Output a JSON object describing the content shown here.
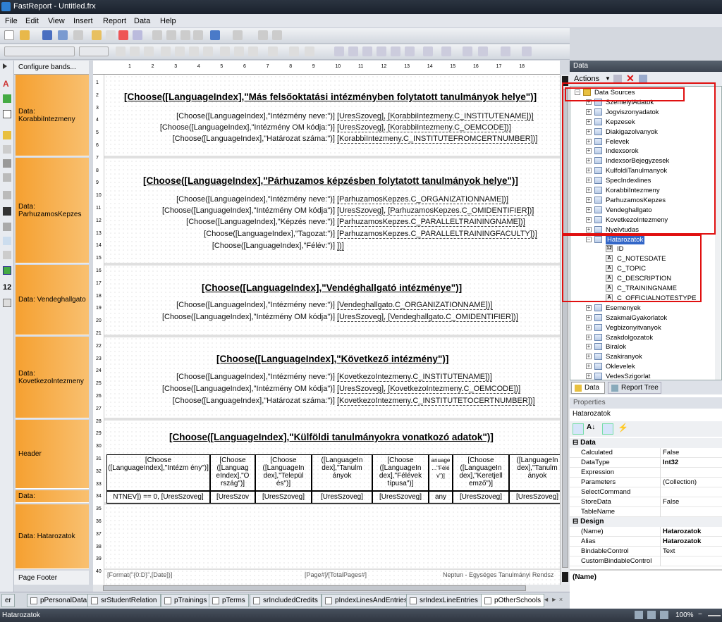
{
  "window": {
    "title": "FastReport - Untitled.frx"
  },
  "menu": [
    "File",
    "Edit",
    "View",
    "Insert",
    "Report",
    "Data",
    "Help"
  ],
  "bands": {
    "header": "Configure bands...",
    "items": [
      "Data:\nKorabbiIntezmeny",
      "Data:\nParhuzamosKepzes",
      "Data: Vendeghallgato",
      "Data:\nKovetkezoIntezmeny",
      "Header",
      "Data:",
      "Data: Hatarozatok"
    ],
    "footer": "Page Footer"
  },
  "ruler": {
    "h": [
      "1",
      "2",
      "3",
      "4",
      "5",
      "6",
      "7",
      "8",
      "9",
      "10",
      "11",
      "12",
      "13",
      "14",
      "15",
      "16",
      "17",
      "18"
    ],
    "v": [
      "1",
      "2",
      "3",
      "4",
      "5",
      "6",
      "7",
      "8",
      "9",
      "10",
      "11",
      "12",
      "13",
      "14",
      "15",
      "16",
      "17",
      "18",
      "19",
      "20",
      "21",
      "22",
      "23",
      "24",
      "25",
      "26",
      "27",
      "28",
      "29",
      "30",
      "31",
      "32",
      "33",
      "34",
      "35",
      "36",
      "37",
      "38",
      "39",
      "40"
    ]
  },
  "report": {
    "s1": {
      "title": "[Choose([LanguageIndex],\"Más felsőoktatási intézményben folytatott tanulmányok helye\")]",
      "rows": [
        [
          "[Choose([LanguageIndex],\"Intézmény  neve:\")]",
          "[UresSzoveg],  [KorabbiIntezmeny.C_INSTITUTENAME])]"
        ],
        [
          "[Choose([LanguageIndex],\"Intézmény OM kódja:\")]",
          "[UresSzoveg],  [KorabbiIntezmeny.C_OEMCODE])]"
        ],
        [
          "[Choose([LanguageIndex],\"Határozat  száma:\")]",
          "[KorabbiIntezmeny.C_INSTITUTEFROMCERTNUMBER])]"
        ]
      ]
    },
    "s2": {
      "title": "[Choose([LanguageIndex],\"Párhuzamos képzésben folytatott tanulmányok helye\")]",
      "rows": [
        [
          "[Choose([LanguageIndex],\"Intézmény  neve:\")]",
          "[ParhuzamosKepzes.C_ORGANIZATIONNAME])]"
        ],
        [
          "[Choose([LanguageIndex],\"Intézmény OM kódja\")]",
          "[UresSzoveg],  [ParhuzamosKepzes.C_OMIDENTIFIER])]"
        ],
        [
          "[Choose([LanguageIndex],\"Képzés  neve:\")]",
          "[ParhuzamosKepzes.C_PARALLELTRAININGNAME])]"
        ],
        [
          "[Choose([LanguageIndex],\"Tagozat:\")]",
          "[ParhuzamosKepzes.C_PARALLELTRAININGFACULTY])]"
        ],
        [
          "[Choose([LanguageIndex],\"Félév:\")]",
          "])]"
        ]
      ]
    },
    "s3": {
      "title": "[Choose([LanguageIndex],\"Vendéghallgató intézménye\")]",
      "rows": [
        [
          "[Choose([LanguageIndex],\"Intézmény  neve:\")]",
          "[Vendeghallgato.C_ORGANIZATIONNAME])]"
        ],
        [
          "[Choose([LanguageIndex],\"Intézmény OM kódja\")]",
          "[UresSzoveg],  [Vendeghallgato.C_OMIDENTIFIER])]"
        ]
      ]
    },
    "s4": {
      "title": "[Choose([LanguageIndex],\"Következő intézmény\")]",
      "rows": [
        [
          "[Choose([LanguageIndex],\"Intézmény  neve:\")]",
          "[KovetkezoIntezmeny.C_INSTITUTENAME])]"
        ],
        [
          "[Choose([LanguageIndex],\"Intézmény OM kódja\")]",
          "[UresSzoveg],  [KovetkezoIntezmeny.C_OEMCODE])]"
        ],
        [
          "[Choose([LanguageIndex],\"Határozat  száma:\")]",
          "[KovetkezoIntezmeny.C_INSTITUTETOCERTNUMBER])]"
        ]
      ]
    },
    "s5": {
      "title": "[Choose([LanguageIndex],\"Külföldi tanulmányokra vonatkozó adatok\")]",
      "headers": [
        "[Choose ([LanguageIndex],\"Intézm ény\")]",
        "[Choose ([Languag eIndex],\"O rszág\")]",
        "[Choose ([LanguageIn dex],\"Települ és\")]",
        "([LanguageIn dex],\"Tanulm ányok",
        "[Choose ([LanguageIn dex],\"Félévek típusa\")]",
        "anuage ...\"Félé v\")]",
        "[Choose ([LanguageIn dex],\"Keretjell emző\")]",
        "([LanguageIn dex],\"Tanulm ányok"
      ],
      "values": [
        "NTNEV]) == 0, [UresSzoveg]",
        "[UresSzov",
        "[UresSzoveg]",
        "[UresSzoveg]",
        "[UresSzoveg]",
        "any",
        "[UresSzoveg]",
        "[UresSzoveg]"
      ]
    },
    "footer": [
      "[Format(\"{0:D}\",[Date])]",
      "[Page#]/[TotalPages#]",
      "Neptun - Egységes Tanulmányi Rendsz"
    ]
  },
  "pagetabs": [
    "er",
    "pPersonalData",
    "srStudentRelation",
    "pTrainings",
    "pTerms",
    "srIncludedCredits",
    "pIndexLinesAndEntries",
    "srIndexLineEntries",
    "pOtherSchools"
  ],
  "status": {
    "left": "Hatarozatok",
    "zoom": "100%"
  },
  "data_panel": {
    "title": "Data",
    "actions": "Actions",
    "root": "Data Sources",
    "tables": [
      "SzemelyiAdatok",
      "Jogviszonyadatok",
      "Kepzesek",
      "Diakigazolvanyok",
      "Felevek",
      "Indexsorok",
      "IndexsorBejegyzesek",
      "KulfoldiTanulmanyok",
      "SpecIndexlines",
      "KorabbiIntezmeny",
      "ParhuzamosKepzes",
      "Vendeghallgato",
      "KovetkezoIntezmeny",
      "Nyelvtudas",
      "Hatarozatok"
    ],
    "fields": [
      {
        "type": "12",
        "name": "ID"
      },
      {
        "type": "A",
        "name": "C_NOTESDATE"
      },
      {
        "type": "A",
        "name": "C_TOPIC"
      },
      {
        "type": "A",
        "name": "C_DESCRIPTION"
      },
      {
        "type": "A",
        "name": "C_TRAININGNAME"
      },
      {
        "type": "A",
        "name": "C_OFFICIALNOTESTYPE"
      }
    ],
    "tables_after": [
      "Esemenyek",
      "SzakmaiGyakorlatok",
      "Vegbizonyitvanyok",
      "Szakdolgozatok",
      "Biralok",
      "Szakiranyok",
      "Oklevelek",
      "VedesSzigorlat"
    ],
    "tabs": [
      "Data",
      "Report Tree"
    ]
  },
  "properties": {
    "title": "Properties",
    "object": "Hatarozatok",
    "cat1": "Data",
    "rows1": [
      [
        "Calculated",
        "False"
      ],
      [
        "DataType",
        "Int32"
      ],
      [
        "Expression",
        ""
      ],
      [
        "Parameters",
        "(Collection)"
      ],
      [
        "SelectCommand",
        ""
      ],
      [
        "StoreData",
        "False"
      ],
      [
        "TableName",
        ""
      ]
    ],
    "cat2": "Design",
    "rows2": [
      [
        "(Name)",
        "Hatarozatok"
      ],
      [
        "Alias",
        "Hatarozatok"
      ],
      [
        "BindableControl",
        "Text"
      ],
      [
        "CustomBindableControl",
        ""
      ]
    ],
    "desc": "(Name)"
  }
}
